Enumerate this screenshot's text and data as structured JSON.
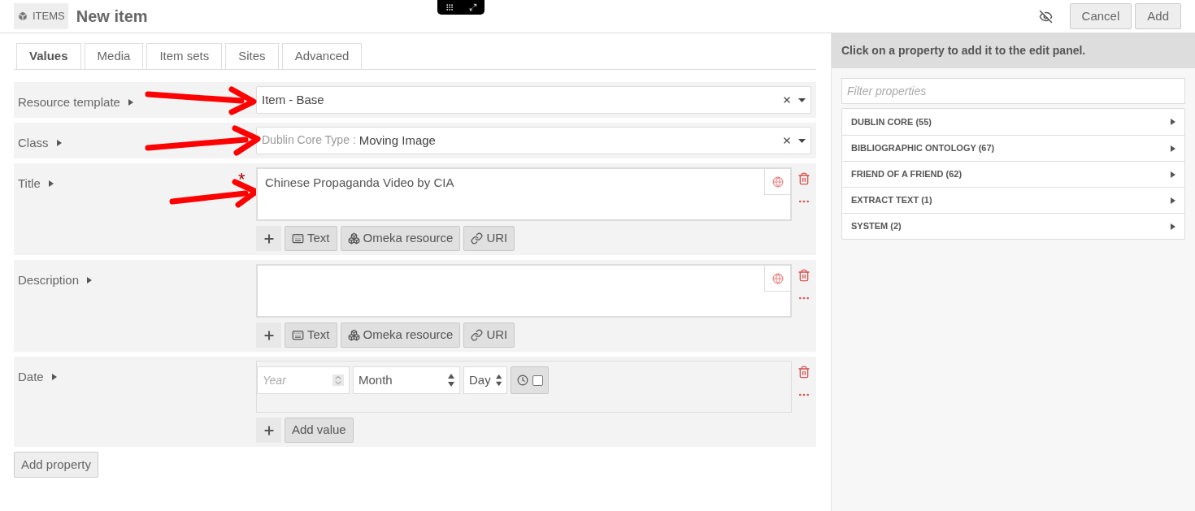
{
  "header": {
    "badge": "ITEMS",
    "title": "New item",
    "buttons": [
      "Cancel",
      "Add"
    ]
  },
  "tabs": [
    {
      "label": "Values",
      "selected": true
    },
    {
      "label": "Media",
      "selected": false
    },
    {
      "label": "Item sets",
      "selected": false
    },
    {
      "label": "Sites",
      "selected": false
    },
    {
      "label": "Advanced",
      "selected": false
    }
  ],
  "properties": [
    {
      "kind": "select",
      "label": "Resource template",
      "value": "Item - Base",
      "arrow": true
    },
    {
      "kind": "select",
      "label": "Class",
      "prefix": "Dublin Core Type :",
      "value": "Moving Image",
      "arrow": true
    },
    {
      "kind": "text",
      "label": "Title",
      "required_mark": "*",
      "value": "Chinese Propaganda Video by CIA",
      "types": [
        "Text",
        "Omeka resource",
        "URI"
      ],
      "arrow": true
    },
    {
      "kind": "text",
      "label": "Description",
      "types": [
        "Text",
        "Omeka resource",
        "URI"
      ],
      "arrow": false
    },
    {
      "kind": "date",
      "label": "Date",
      "year_placeholder": "Year",
      "month": "Month",
      "day": "Day",
      "time_checked": false,
      "add": "Add value",
      "arrow": false
    }
  ],
  "add_property": "Add property",
  "sidebar": {
    "instruction": "Click on a property to add it to the edit panel.",
    "filter_placeholder": "Filter properties",
    "groups": [
      "DUBLIN CORE (55)",
      "BIBLIOGRAPHIC ONTOLOGY (67)",
      "FRIEND OF A FRIEND (62)",
      "EXTRACT TEXT (1)",
      "SYSTEM (2)"
    ]
  }
}
